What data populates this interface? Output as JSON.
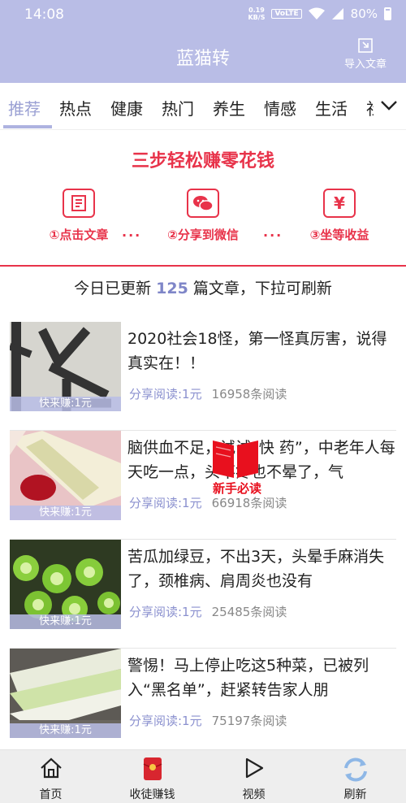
{
  "status_bar": {
    "time": "14:08",
    "net_speed": "0.19",
    "net_unit": "KB/S",
    "volte": "VoLTE",
    "battery": "80%"
  },
  "header": {
    "title": "蓝猫转",
    "import_label": "导入文章"
  },
  "tabs": [
    "推荐",
    "热点",
    "健康",
    "热门",
    "养生",
    "情感",
    "生活",
    "社"
  ],
  "banner": {
    "title": "三步轻松赚零花钱",
    "steps": [
      {
        "label": "①点击文章",
        "icon": "document-icon"
      },
      {
        "label": "②分享到微信",
        "icon": "wechat-icon"
      },
      {
        "label": "③坐等收益",
        "icon": "yen-icon",
        "glyph": "¥"
      }
    ],
    "separator": "···"
  },
  "notice": {
    "prefix": "今日已更新 ",
    "count": "125",
    "suffix": " 篇文章，下拉可刷新"
  },
  "articles": [
    {
      "title": "2020社会18怪，第一怪真厉害，说得真实在！！",
      "earn": "快来赚:1元",
      "share": "分享阅读:1元",
      "reads": "16958条阅读"
    },
    {
      "title": "脑供血不足，试试“快 药”，中老年人每天吃一点，头不疼也不晕了，气",
      "earn": "快来赚:1元",
      "share": "分享阅读:1元",
      "reads": "66918条阅读"
    },
    {
      "title": "苦瓜加绿豆，不出3天，头晕手麻消失了，颈椎病、肩周炎也没有",
      "earn": "快来赚:1元",
      "share": "分享阅读:1元",
      "reads": "25485条阅读"
    },
    {
      "title": "警惕！马上停止吃这5种菜，已被列入“黑名单”，赶紧转告家人朋",
      "earn": "快来赚:1元",
      "share": "分享阅读:1元",
      "reads": "75197条阅读"
    }
  ],
  "float_badge": {
    "label": "新手必读"
  },
  "bottom_nav": [
    {
      "label": "首页",
      "icon": "home-icon"
    },
    {
      "label": "收徒赚钱",
      "icon": "red-envelope-icon"
    },
    {
      "label": "视频",
      "icon": "play-icon"
    },
    {
      "label": "刷新",
      "icon": "refresh-icon"
    }
  ],
  "colors": {
    "header_bg": "#b9bde6",
    "accent_red": "#e8334a",
    "accent_blue": "#8b91cf"
  }
}
